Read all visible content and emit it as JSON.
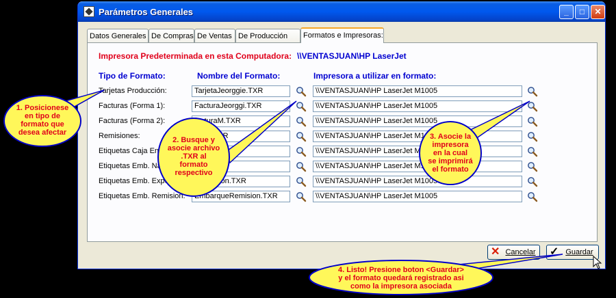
{
  "window": {
    "title": "Parámetros Generales"
  },
  "tabs": [
    {
      "label": "Datos Generales"
    },
    {
      "label": "De Compras"
    },
    {
      "label": "De Ventas"
    },
    {
      "label": "De Producción"
    },
    {
      "label": "Formatos e Impresoras:"
    }
  ],
  "printer_default": {
    "label": "Impresora Predeterminada en esta Computadora:",
    "value": "\\\\VENTASJUAN\\HP LaserJet"
  },
  "columns": {
    "type": "Tipo de Formato:",
    "name": "Nombre del Formato:",
    "printer": "Impresora a utilizar en formato:"
  },
  "rows": [
    {
      "label": "Tarjetas Producción:",
      "file": "TarjetaJeorggie.TXR",
      "printer": "\\\\VENTASJUAN\\HP LaserJet M1005"
    },
    {
      "label": "Facturas (Forma 1):",
      "file": "FacturaJeorggi.TXR",
      "printer": "\\\\VENTASJUAN\\HP LaserJet M1005"
    },
    {
      "label": "Facturas (Forma 2):",
      "file": "facturaM.TXR",
      "printer": "\\\\VENTASJUAN\\HP LaserJet M1005"
    },
    {
      "label": "Remisiones:",
      "file": "orggi.TXR",
      "printer": "\\\\VENTASJUAN\\HP LaserJet M1005"
    },
    {
      "label": "Etiquetas Caja Env",
      "file": "4.TXR",
      "printer": "\\\\VENTASJUAN\\HP LaserJet M1005"
    },
    {
      "label": "Etiquetas Emb. Na",
      "file": "ional.TXR",
      "printer": "\\\\VENTASJUAN\\HP LaserJet M1005"
    },
    {
      "label": "Etiquetas Emb. Expor",
      "file": "xportacion.TXR",
      "printer": "\\\\VENTASJUAN\\HP LaserJet M1005"
    },
    {
      "label": "Etiquetas Emb. Remision:",
      "file": "EmbarqueRemision.TXR",
      "printer": "\\\\VENTASJUAN\\HP LaserJet M1005"
    }
  ],
  "buttons": {
    "cancel": "Cancelar",
    "save": "Guardar"
  },
  "callouts": {
    "c1": [
      "1. Posicionese",
      "en tipo de",
      "formato que",
      "desea afectar"
    ],
    "c2": [
      "2. Busque y",
      "asocie archivo",
      ".TXR al",
      "formato",
      "respectivo"
    ],
    "c3": [
      "3. Asocie la",
      "impresora",
      "en la cual",
      "se imprimirá",
      "el formato"
    ],
    "c4": [
      "4. Listo! Presione boton <Guardar>",
      "y el formato quedará registrado asi",
      "como la impresora asociada"
    ]
  },
  "icons": {
    "search": "magnifier-icon",
    "cancel": "red-x-icon",
    "save": "checkmark-icon"
  },
  "colors": {
    "accent_red": "#e0001b",
    "label_blue": "#0000d0",
    "callout_fill": "#fff75a",
    "callout_border": "#0000c8"
  }
}
